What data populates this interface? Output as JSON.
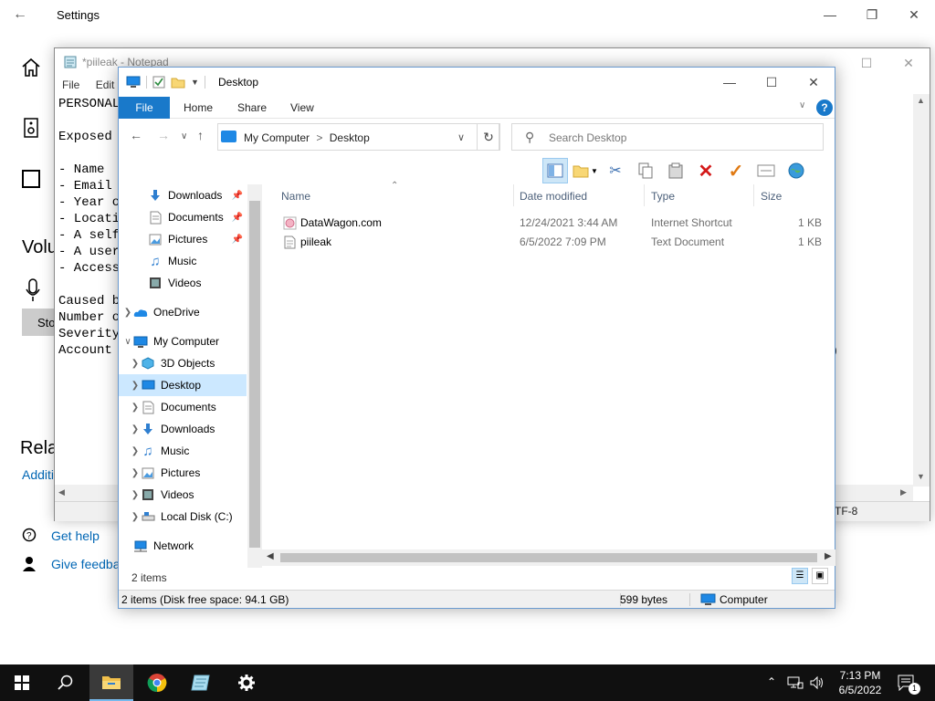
{
  "settings": {
    "title": "Settings",
    "volume_heading": "Volu",
    "stop_label": "Sto",
    "related_heading": "Rela",
    "additional_link": "Additi",
    "get_help": "Get help",
    "give_feedback": "Give feedba"
  },
  "notepad": {
    "title": "*piileak - Notepad",
    "menu": [
      "File",
      "Edit"
    ],
    "lines": [
      "PERSONAL",
      "",
      "Exposed",
      "",
      "- Name",
      "- Email",
      "- Year o",
      "- Locati",
      "- A self",
      "- A user",
      "- Access",
      "",
      "Caused b",
      "Number o",
      "Severity",
      "Account"
    ],
    "side_fragment": ")",
    "encoding_fragment": "TF-8"
  },
  "explorer": {
    "title": "Desktop",
    "tabs": {
      "file": "File",
      "home": "Home",
      "share": "Share",
      "view": "View"
    },
    "help_label": "?",
    "address": {
      "root": "My Computer",
      "separator": ">",
      "current": "Desktop"
    },
    "search_placeholder": "Search Desktop",
    "nav_pane": {
      "quick_access": [
        {
          "label": "Downloads",
          "icon": "downloads-icon",
          "pinned": true
        },
        {
          "label": "Documents",
          "icon": "documents-icon",
          "pinned": true
        },
        {
          "label": "Pictures",
          "icon": "pictures-icon",
          "pinned": true
        },
        {
          "label": "Music",
          "icon": "music-icon",
          "pinned": false
        },
        {
          "label": "Videos",
          "icon": "videos-icon",
          "pinned": false
        }
      ],
      "onedrive": "OneDrive",
      "my_computer": "My Computer",
      "computer_items": [
        {
          "label": "3D Objects",
          "icon": "3d-objects-icon"
        },
        {
          "label": "Desktop",
          "icon": "desktop-icon",
          "selected": true
        },
        {
          "label": "Documents",
          "icon": "documents-icon"
        },
        {
          "label": "Downloads",
          "icon": "downloads-icon"
        },
        {
          "label": "Music",
          "icon": "music-icon"
        },
        {
          "label": "Pictures",
          "icon": "pictures-icon"
        },
        {
          "label": "Videos",
          "icon": "videos-icon"
        },
        {
          "label": "Local Disk (C:)",
          "icon": "local-disk-icon"
        }
      ],
      "network": "Network"
    },
    "columns": {
      "name": "Name",
      "date": "Date modified",
      "type": "Type",
      "size": "Size"
    },
    "files": [
      {
        "name": "DataWagon.com",
        "date": "12/24/2021 3:44 AM",
        "type": "Internet Shortcut",
        "size": "1 KB",
        "icon": "internet-shortcut-icon"
      },
      {
        "name": "piileak",
        "date": "6/5/2022 7:09 PM",
        "type": "Text Document",
        "size": "1 KB",
        "icon": "text-document-icon"
      }
    ],
    "item_count": "2 items",
    "status": {
      "summary": "2 items (Disk free space: 94.1 GB)",
      "bytes": "599 bytes",
      "location": "Computer"
    }
  },
  "taskbar": {
    "time": "7:13 PM",
    "date": "6/5/2022",
    "notification_count": "1"
  },
  "colors": {
    "accent": "#1979ca",
    "selection": "#cce8ff",
    "taskbar": "#101010"
  }
}
